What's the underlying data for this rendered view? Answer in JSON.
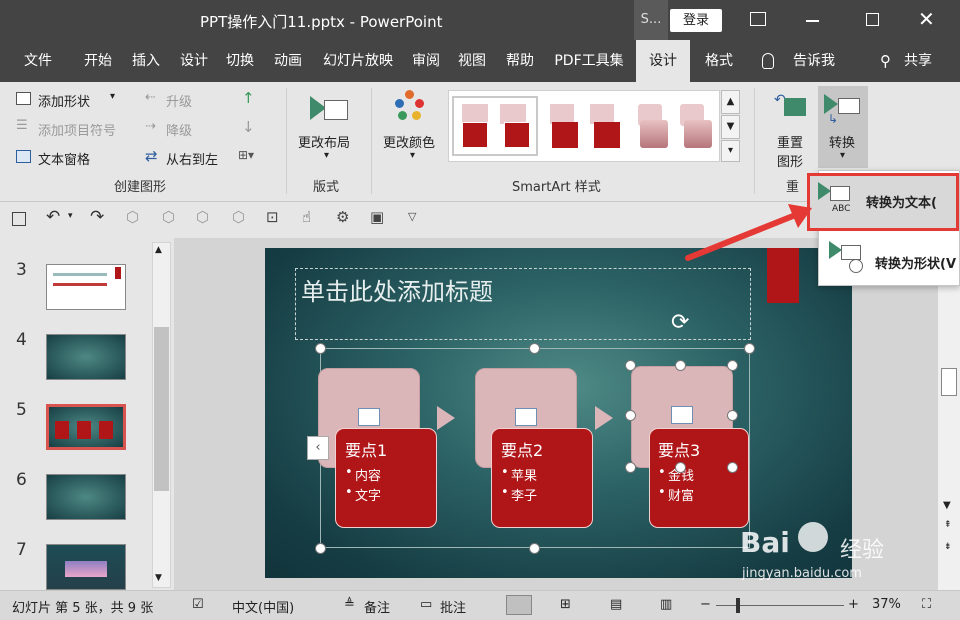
{
  "titlebar": {
    "title": "PPT操作入门11.pptx - PowerPoint",
    "search_glyph": "S...",
    "login_label": "登录"
  },
  "tabs": [
    {
      "label": "文件"
    },
    {
      "label": "开始"
    },
    {
      "label": "插入"
    },
    {
      "label": "设计"
    },
    {
      "label": "切换"
    },
    {
      "label": "动画"
    },
    {
      "label": "幻灯片放映"
    },
    {
      "label": "审阅"
    },
    {
      "label": "视图"
    },
    {
      "label": "帮助"
    },
    {
      "label": "PDF工具集"
    },
    {
      "label": "设计"
    },
    {
      "label": "格式"
    }
  ],
  "tellme": "告诉我",
  "share": "共享",
  "ribbon": {
    "create": {
      "add_shape": "添加形状",
      "add_bullet": "添加项目符号",
      "text_pane": "文本窗格",
      "promote": "升级",
      "demote": "降级",
      "rtl": "从右到左",
      "group_label": "创建图形"
    },
    "layout": {
      "label": "更改布局",
      "group_label": "版式"
    },
    "styles": {
      "change_colors": "更改颜色",
      "group_label": "SmartArt 样式"
    },
    "reset": {
      "label_line1": "重置",
      "label_line2": "图形",
      "group_label": "重"
    },
    "convert": {
      "label": "转换"
    }
  },
  "dropdown": {
    "to_text": "转换为文本(",
    "to_shapes": "转换为形状(V"
  },
  "thumbs": [
    {
      "num": "3"
    },
    {
      "num": "4"
    },
    {
      "num": "5"
    },
    {
      "num": "6"
    },
    {
      "num": "7"
    }
  ],
  "slide": {
    "title_placeholder": "单击此处添加标题",
    "items": [
      {
        "title": "要点1",
        "b1": "内容",
        "b2": "文字"
      },
      {
        "title": "要点2",
        "b1": "苹果",
        "b2": "李子"
      },
      {
        "title": "要点3",
        "b1": "金钱",
        "b2": "财富"
      }
    ]
  },
  "status": {
    "slide_info": "幻灯片 第 5 张，共 9 张",
    "lang": "中文(中国)",
    "notes": "备注",
    "comments": "批注",
    "zoom": "37%"
  },
  "watermark": {
    "brand": "Bai",
    "brand2": "经验",
    "url": "jingyan.baidu.com"
  },
  "colors": {
    "accent_red": "#e53935",
    "ribbon_bg": "#e6e6e6",
    "title_bg": "#444444"
  }
}
